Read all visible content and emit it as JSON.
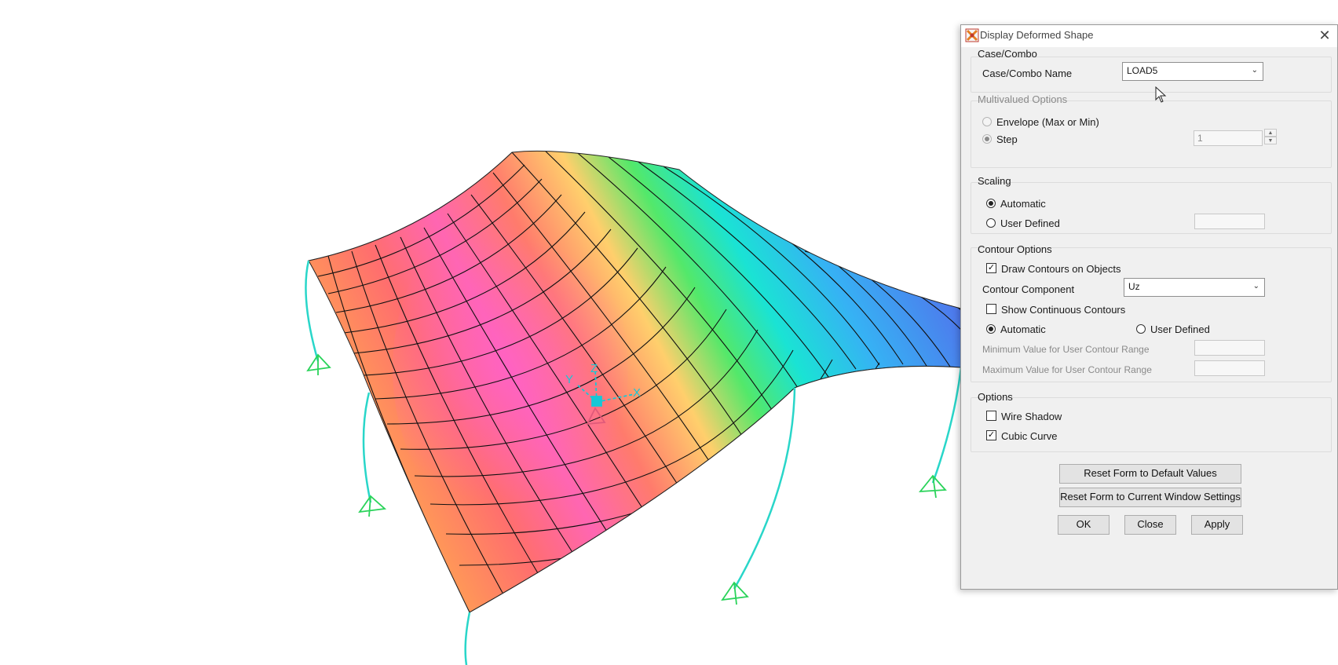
{
  "dialog": {
    "title": "Display Deformed Shape",
    "case_combo": {
      "group_title": "Case/Combo",
      "name_label": "Case/Combo Name",
      "name_value": "LOAD5"
    },
    "multivalued": {
      "group_title": "Multivalued Options",
      "envelope_label": "Envelope (Max or Min)",
      "step_label": "Step",
      "step_value": "1"
    },
    "scaling": {
      "group_title": "Scaling",
      "automatic_label": "Automatic",
      "user_defined_label": "User Defined"
    },
    "contour": {
      "group_title": "Contour Options",
      "draw_contours_label": "Draw Contours on Objects",
      "component_label": "Contour Component",
      "component_value": "Uz",
      "show_continuous_label": "Show Continuous Contours",
      "automatic_label": "Automatic",
      "user_defined_label": "User Defined",
      "min_label": "Minimum Value for User Contour Range",
      "max_label": "Maximum Value for User Contour Range"
    },
    "options": {
      "group_title": "Options",
      "wire_shadow_label": "Wire Shadow",
      "cubic_curve_label": "Cubic Curve"
    },
    "buttons": {
      "reset_default": "Reset Form to Default Values",
      "reset_current": "Reset Form to Current Window Settings",
      "ok": "OK",
      "close": "Close",
      "apply": "Apply"
    },
    "state": {
      "step_selected": true,
      "scaling_automatic": true,
      "draw_contours": true,
      "show_continuous": false,
      "contour_automatic": true,
      "wire_shadow": false,
      "cubic_curve": true
    }
  },
  "viewport": {
    "axes": {
      "x": "X",
      "y": "Y",
      "z": "Z"
    },
    "contour_colors": [
      "#ff66b2",
      "#ff6f6f",
      "#ff9a5c",
      "#ffd36e",
      "#f5f57a",
      "#66e86b",
      "#19e3d0",
      "#2fb6f2",
      "#5b8ff0",
      "#4a6fe8"
    ]
  }
}
